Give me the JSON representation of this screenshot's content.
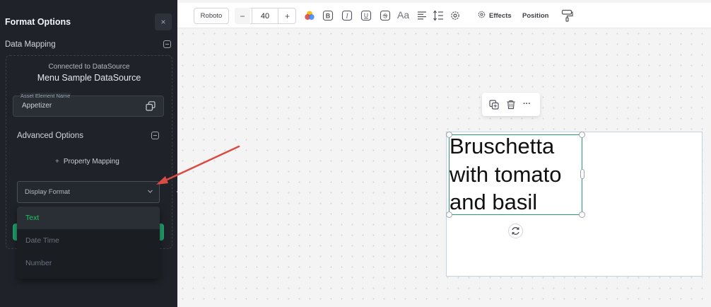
{
  "sidebar": {
    "title": "Format Options",
    "close_icon": "×",
    "data_mapping_title": "Data Mapping",
    "connected_label": "Connected to DataSource",
    "datasource_name": "Menu Sample DataSource",
    "asset_field": {
      "label": "Asset Element Name",
      "value": "Appetizer"
    },
    "advanced_title": "Advanced Options",
    "property_mapping_label": "Property Mapping",
    "display_format": {
      "placeholder": "Display Format",
      "options": [
        "Text",
        "Date Time",
        "Number"
      ],
      "selected": "Text"
    }
  },
  "toolbar": {
    "font": "Roboto",
    "font_size": "40",
    "minus": "−",
    "plus": "+",
    "effects_label": "Effects",
    "position_label": "Position",
    "font_size_glyph": "Aa",
    "icons": [
      "color-palette-icon",
      "bold-icon",
      "italic-icon",
      "underline-icon",
      "strikethrough-icon",
      "font-size-icon",
      "align-icon",
      "line-height-icon",
      "settings-icon",
      "effects-icon",
      "format-painter-icon"
    ]
  },
  "canvas": {
    "text_element": {
      "lines": [
        "Bruschetta",
        "with tomato",
        "and basil"
      ]
    },
    "more_glyph": "···"
  },
  "colors": {
    "sidebar_bg": "#1f2329",
    "accent_green": "#22a06b",
    "selected_text": "#22c55e",
    "annotation_arrow": "#d94b43"
  }
}
